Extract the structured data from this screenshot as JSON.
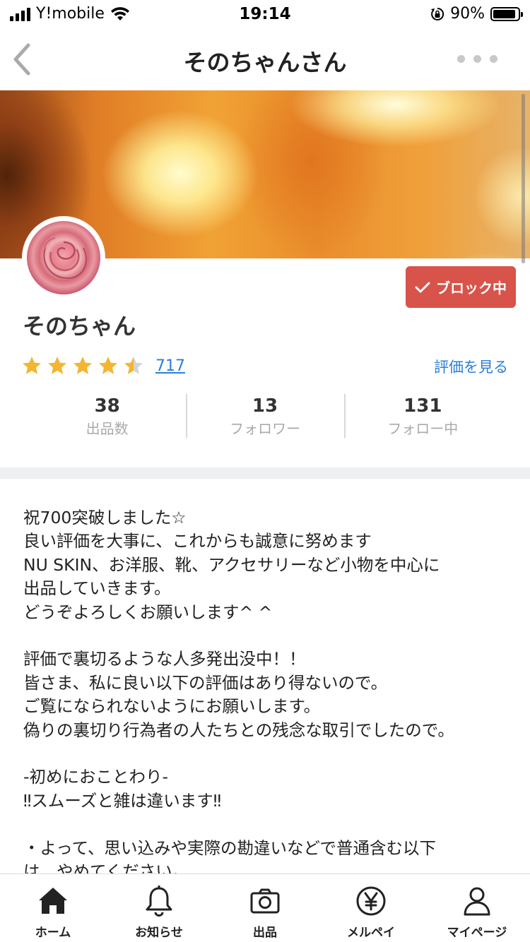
{
  "status_bar": {
    "carrier": "Y!mobile",
    "time": "19:14",
    "battery": "90%",
    "battery_level": 0.9
  },
  "nav": {
    "title": "そのちゃんさん"
  },
  "profile": {
    "name": "そのちゃん",
    "block_label": "ブロック中",
    "rating_stars": 4.5,
    "rating_count": "717",
    "see_reviews": "評価を見る"
  },
  "stats": [
    {
      "value": "38",
      "label": "出品数"
    },
    {
      "value": "13",
      "label": "フォロワー"
    },
    {
      "value": "131",
      "label": "フォロー中"
    }
  ],
  "bio_lines": [
    "祝700突破しました☆",
    "良い評価を大事に、これからも誠意に努めます",
    "NU SKIN、お洋服、靴、アクセサリーなど小物を中心に",
    "出品していきます。",
    "どうぞよろしくお願いします^ ^",
    "",
    "評価で裏切るような人多発出没中！！",
    "皆さま、私に良い以下の評価はあり得ないので。",
    "ご覧になられないようにお願いします。",
    "偽りの裏切り行為者の人たちとの残念な取引でしたので。",
    "",
    "-初めにおことわり-",
    "‼︎スムーズと雑は違います‼︎",
    "",
    "・よって、思い込みや実際の勘違いなどで普通含む以下",
    "は、やめてください。"
  ],
  "tabs": [
    {
      "label": "ホーム",
      "icon": "home-icon"
    },
    {
      "label": "お知らせ",
      "icon": "bell-icon"
    },
    {
      "label": "出品",
      "icon": "camera-icon"
    },
    {
      "label": "メルペイ",
      "icon": "yen-icon"
    },
    {
      "label": "マイページ",
      "icon": "person-icon"
    }
  ],
  "colors": {
    "block_red": "#d8544a",
    "link_blue": "#2b7ed8",
    "star_gold": "#f2b632"
  }
}
